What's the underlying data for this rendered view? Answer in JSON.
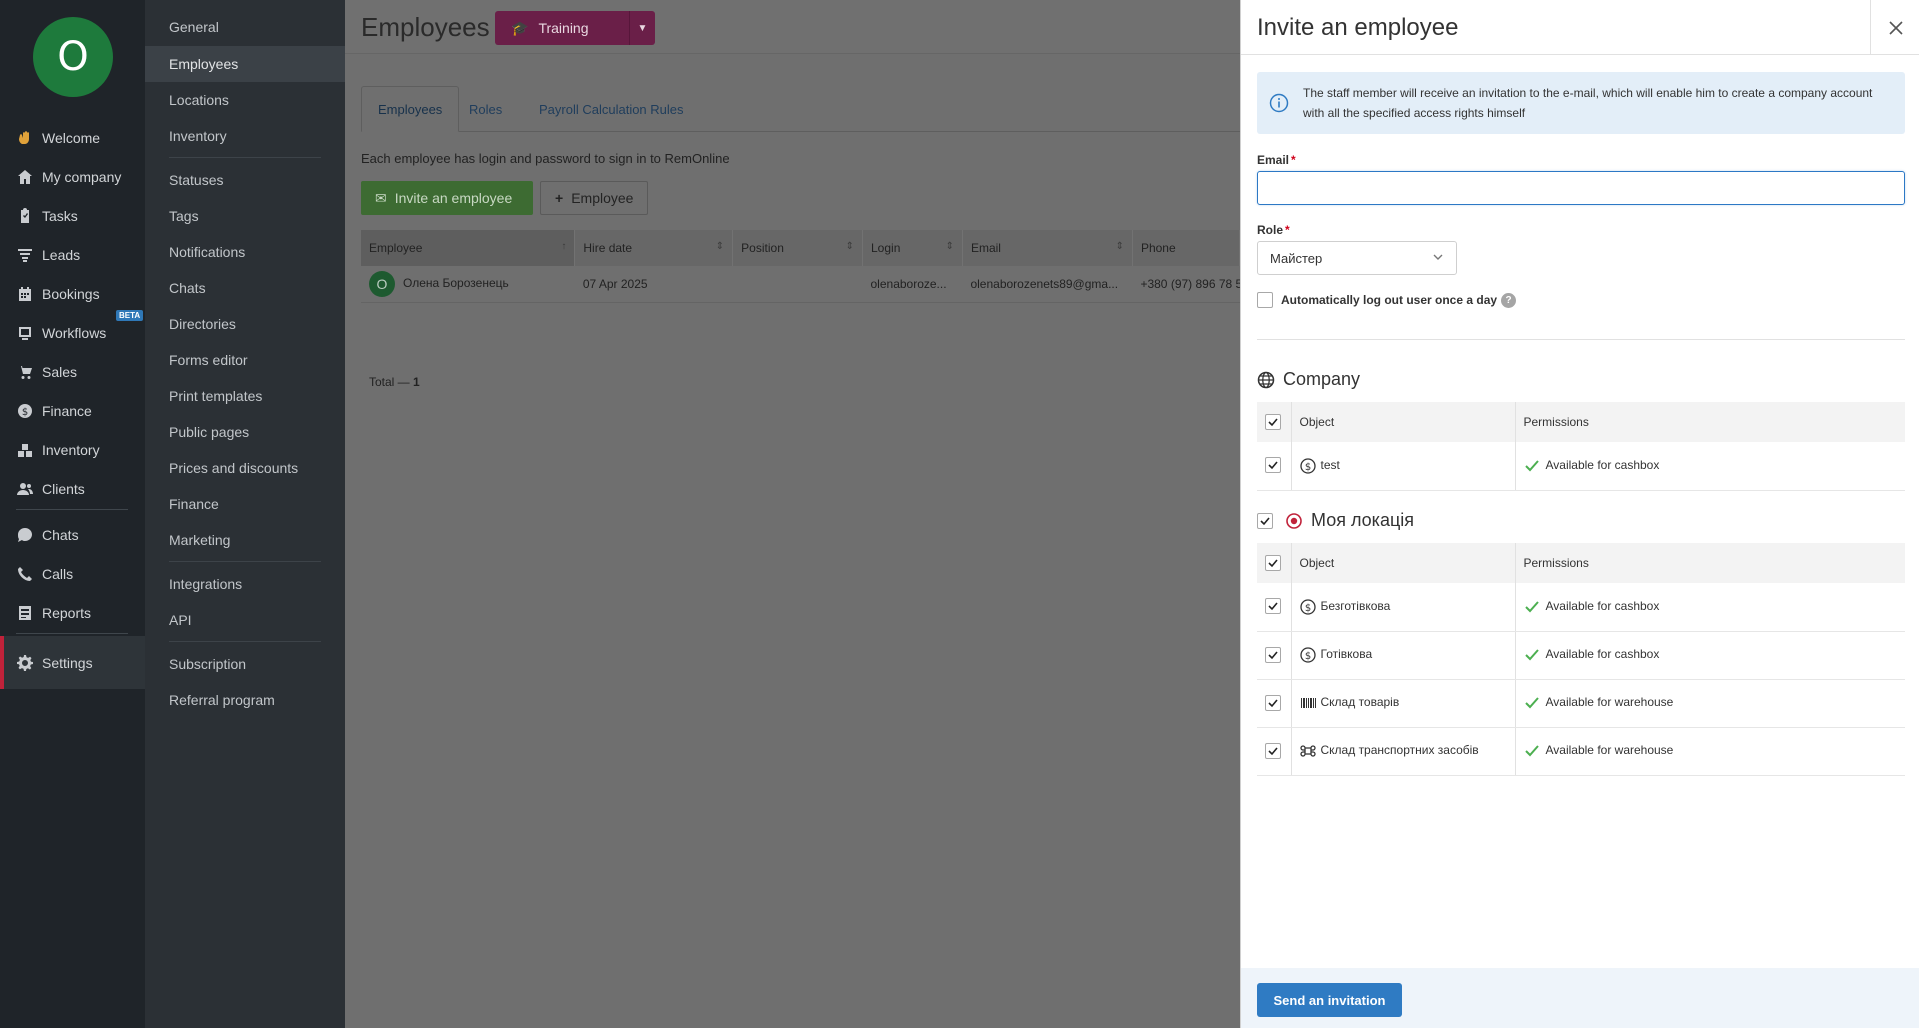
{
  "user": {
    "avatar_initial": "O"
  },
  "nav": {
    "items": [
      {
        "label": "Welcome",
        "icon": "wave-icon"
      },
      {
        "label": "My company",
        "icon": "home-icon"
      },
      {
        "label": "Tasks",
        "icon": "clipboard-icon"
      },
      {
        "label": "Leads",
        "icon": "funnel-icon"
      },
      {
        "label": "Bookings",
        "icon": "calendar-icon"
      },
      {
        "label": "Workflows",
        "icon": "workflow-icon"
      },
      {
        "label": "Sales",
        "icon": "cart-icon"
      },
      {
        "label": "Finance",
        "icon": "dollar-icon"
      },
      {
        "label": "Inventory",
        "icon": "boxes-icon"
      },
      {
        "label": "Clients",
        "icon": "people-icon"
      },
      {
        "label": "Chats",
        "icon": "chat-icon"
      },
      {
        "label": "Calls",
        "icon": "phone-icon"
      },
      {
        "label": "Reports",
        "icon": "report-icon"
      },
      {
        "label": "Settings",
        "icon": "gear-icon"
      }
    ],
    "beta_badge": "BETA"
  },
  "settings_nav": {
    "items": [
      "General",
      "Employees",
      "Locations",
      "Inventory",
      "Statuses",
      "Tags",
      "Notifications",
      "Chats",
      "Directories",
      "Forms editor",
      "Print templates",
      "Public pages",
      "Prices and discounts",
      "Finance",
      "Marketing",
      "Integrations",
      "API",
      "Subscription",
      "Referral program"
    ],
    "active": "Employees"
  },
  "main": {
    "title": "Employees",
    "training_label": "Training",
    "tabs": [
      "Employees",
      "Roles",
      "Payroll Calculation Rules"
    ],
    "description": "Each employee has login and password to sign in to RemOnline",
    "invite_button": "Invite an employee",
    "employee_button": "Employee",
    "table": {
      "columns": [
        "Employee",
        "Hire date",
        "Position",
        "Login",
        "Email",
        "Phone"
      ],
      "rows": [
        {
          "avatar": "O",
          "employee": "Олена Борозенець",
          "hire_date": "07 Apr 2025",
          "position": "",
          "login": "olenaboroze...",
          "email": "olenaborozenets89@gma...",
          "phone": "+380 (97) 896 78 5"
        }
      ]
    },
    "total_label": "Total —",
    "total_value": "1"
  },
  "panel": {
    "title": "Invite an employee",
    "info_text": "The staff member will receive an invitation to the e-mail, which will enable him to create a company account with all the specified access rights himself",
    "email_label": "Email",
    "email_value": "",
    "role_label": "Role",
    "role_value": "Майстер",
    "auto_logout_label": "Automatically log out user once a day",
    "help_glyph": "?",
    "required_mark": "*",
    "sections": [
      {
        "title": "Company",
        "icon": "globe-icon",
        "header": {
          "object": "Object",
          "permissions": "Permissions"
        },
        "rows": [
          {
            "object": "test",
            "icon": "cashbox-icon",
            "permission": "Available for cashbox"
          }
        ]
      },
      {
        "title": "Моя локація",
        "icon": "location-target-icon",
        "header": {
          "object": "Object",
          "permissions": "Permissions"
        },
        "rows": [
          {
            "object": "Безготівкова",
            "icon": "cashbox-icon",
            "permission": "Available for cashbox"
          },
          {
            "object": "Готівкова",
            "icon": "cashbox-icon",
            "permission": "Available for cashbox"
          },
          {
            "object": "Склад товарів",
            "icon": "barcode-icon",
            "permission": "Available for warehouse"
          },
          {
            "object": "Склад транспортних засобів",
            "icon": "command-icon",
            "permission": "Available for warehouse"
          }
        ]
      }
    ],
    "send_button": "Send an invitation"
  },
  "colors": {
    "accent_blue": "#2f7bc3",
    "success_green": "#4caf50",
    "required_red": "#d0021b",
    "active_nav_marker": "#c0223a",
    "training_purple": "#8e2a5f"
  }
}
